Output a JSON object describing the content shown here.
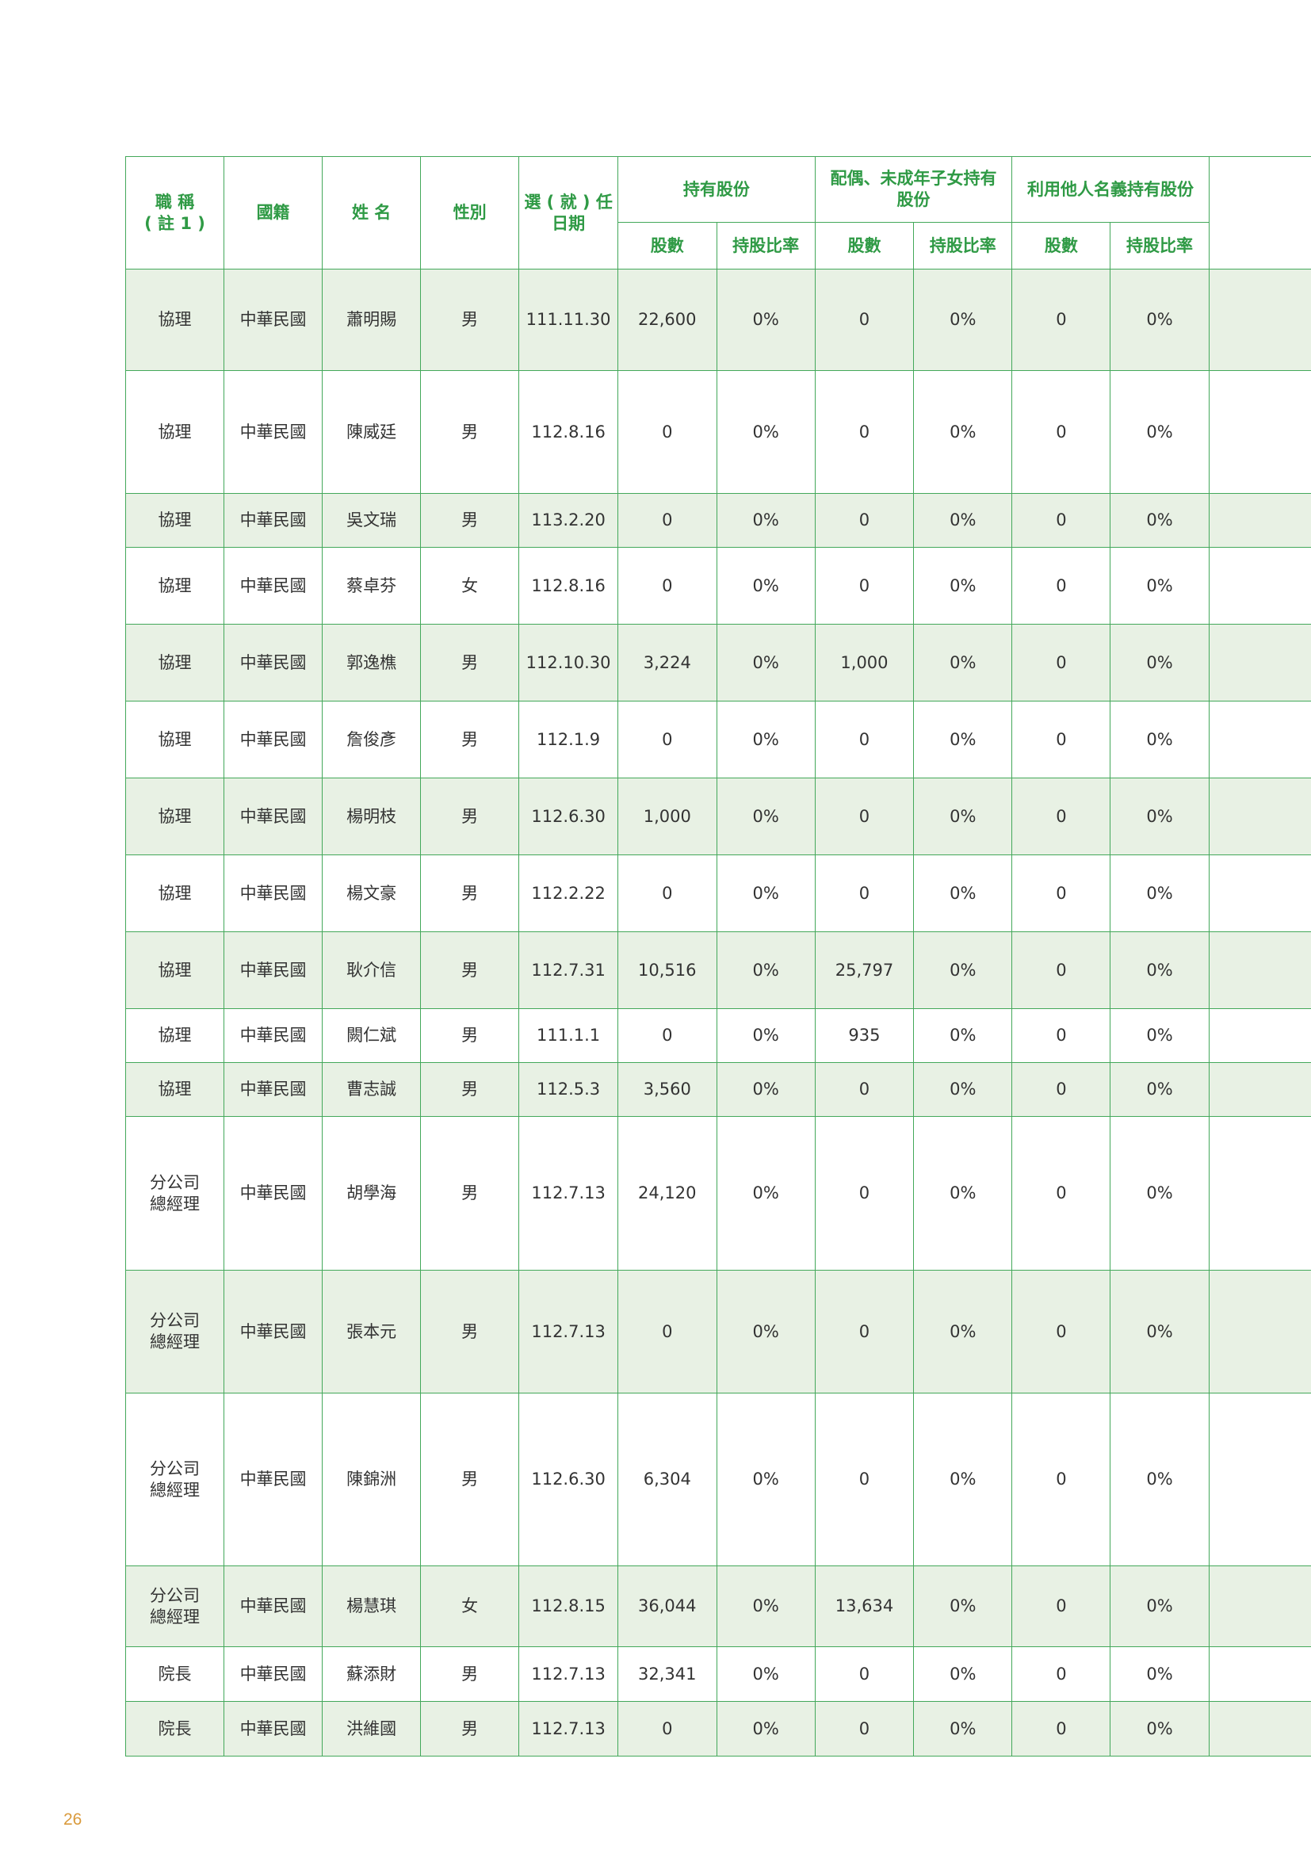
{
  "header": {
    "title": "職 稱\n( 註 1 )",
    "nationality": "國籍",
    "name": "姓 名",
    "gender": "性別",
    "date": "選 ( 就 ) 任\n日期",
    "group_own": "持有股份",
    "group_spouse": "配偶、未成年子女持有\n股份",
    "group_nominee": "利用他人名義持有股份",
    "shares": "股數",
    "ratio": "持股比率"
  },
  "rows": [
    {
      "title": "協理",
      "nat": "中華民國",
      "name": "蕭明賜",
      "gender": "男",
      "date": "111.11.30",
      "own_shares": "22,600",
      "own_ratio": "0%",
      "sp_shares": "0",
      "sp_ratio": "0%",
      "nm_shares": "0",
      "nm_ratio": "0%"
    },
    {
      "title": "協理",
      "nat": "中華民國",
      "name": "陳威廷",
      "gender": "男",
      "date": "112.8.16",
      "own_shares": "0",
      "own_ratio": "0%",
      "sp_shares": "0",
      "sp_ratio": "0%",
      "nm_shares": "0",
      "nm_ratio": "0%"
    },
    {
      "title": "協理",
      "nat": "中華民國",
      "name": "吳文瑞",
      "gender": "男",
      "date": "113.2.20",
      "own_shares": "0",
      "own_ratio": "0%",
      "sp_shares": "0",
      "sp_ratio": "0%",
      "nm_shares": "0",
      "nm_ratio": "0%"
    },
    {
      "title": "協理",
      "nat": "中華民國",
      "name": "蔡卓芬",
      "gender": "女",
      "date": "112.8.16",
      "own_shares": "0",
      "own_ratio": "0%",
      "sp_shares": "0",
      "sp_ratio": "0%",
      "nm_shares": "0",
      "nm_ratio": "0%"
    },
    {
      "title": "協理",
      "nat": "中華民國",
      "name": "郭逸樵",
      "gender": "男",
      "date": "112.10.30",
      "own_shares": "3,224",
      "own_ratio": "0%",
      "sp_shares": "1,000",
      "sp_ratio": "0%",
      "nm_shares": "0",
      "nm_ratio": "0%"
    },
    {
      "title": "協理",
      "nat": "中華民國",
      "name": "詹俊彥",
      "gender": "男",
      "date": "112.1.9",
      "own_shares": "0",
      "own_ratio": "0%",
      "sp_shares": "0",
      "sp_ratio": "0%",
      "nm_shares": "0",
      "nm_ratio": "0%"
    },
    {
      "title": "協理",
      "nat": "中華民國",
      "name": "楊明枝",
      "gender": "男",
      "date": "112.6.30",
      "own_shares": "1,000",
      "own_ratio": "0%",
      "sp_shares": "0",
      "sp_ratio": "0%",
      "nm_shares": "0",
      "nm_ratio": "0%"
    },
    {
      "title": "協理",
      "nat": "中華民國",
      "name": "楊文豪",
      "gender": "男",
      "date": "112.2.22",
      "own_shares": "0",
      "own_ratio": "0%",
      "sp_shares": "0",
      "sp_ratio": "0%",
      "nm_shares": "0",
      "nm_ratio": "0%"
    },
    {
      "title": "協理",
      "nat": "中華民國",
      "name": "耿介信",
      "gender": "男",
      "date": "112.7.31",
      "own_shares": "10,516",
      "own_ratio": "0%",
      "sp_shares": "25,797",
      "sp_ratio": "0%",
      "nm_shares": "0",
      "nm_ratio": "0%"
    },
    {
      "title": "協理",
      "nat": "中華民國",
      "name": "闕仁斌",
      "gender": "男",
      "date": "111.1.1",
      "own_shares": "0",
      "own_ratio": "0%",
      "sp_shares": "935",
      "sp_ratio": "0%",
      "nm_shares": "0",
      "nm_ratio": "0%"
    },
    {
      "title": "協理",
      "nat": "中華民國",
      "name": "曹志誠",
      "gender": "男",
      "date": "112.5.3",
      "own_shares": "3,560",
      "own_ratio": "0%",
      "sp_shares": "0",
      "sp_ratio": "0%",
      "nm_shares": "0",
      "nm_ratio": "0%"
    },
    {
      "title": "分公司\n總經理",
      "nat": "中華民國",
      "name": "胡學海",
      "gender": "男",
      "date": "112.7.13",
      "own_shares": "24,120",
      "own_ratio": "0%",
      "sp_shares": "0",
      "sp_ratio": "0%",
      "nm_shares": "0",
      "nm_ratio": "0%"
    },
    {
      "title": "分公司\n總經理",
      "nat": "中華民國",
      "name": "張本元",
      "gender": "男",
      "date": "112.7.13",
      "own_shares": "0",
      "own_ratio": "0%",
      "sp_shares": "0",
      "sp_ratio": "0%",
      "nm_shares": "0",
      "nm_ratio": "0%"
    },
    {
      "title": "分公司\n總經理",
      "nat": "中華民國",
      "name": "陳錦洲",
      "gender": "男",
      "date": "112.6.30",
      "own_shares": "6,304",
      "own_ratio": "0%",
      "sp_shares": "0",
      "sp_ratio": "0%",
      "nm_shares": "0",
      "nm_ratio": "0%"
    },
    {
      "title": "分公司\n總經理",
      "nat": "中華民國",
      "name": "楊慧琪",
      "gender": "女",
      "date": "112.8.15",
      "own_shares": "36,044",
      "own_ratio": "0%",
      "sp_shares": "13,634",
      "sp_ratio": "0%",
      "nm_shares": "0",
      "nm_ratio": "0%"
    },
    {
      "title": "院長",
      "nat": "中華民國",
      "name": "蘇添財",
      "gender": "男",
      "date": "112.7.13",
      "own_shares": "32,341",
      "own_ratio": "0%",
      "sp_shares": "0",
      "sp_ratio": "0%",
      "nm_shares": "0",
      "nm_ratio": "0%"
    },
    {
      "title": "院長",
      "nat": "中華民國",
      "name": "洪維國",
      "gender": "男",
      "date": "112.7.13",
      "own_shares": "0",
      "own_ratio": "0%",
      "sp_shares": "0",
      "sp_ratio": "0%",
      "nm_shares": "0",
      "nm_ratio": "0%"
    }
  ],
  "page_number": "26"
}
